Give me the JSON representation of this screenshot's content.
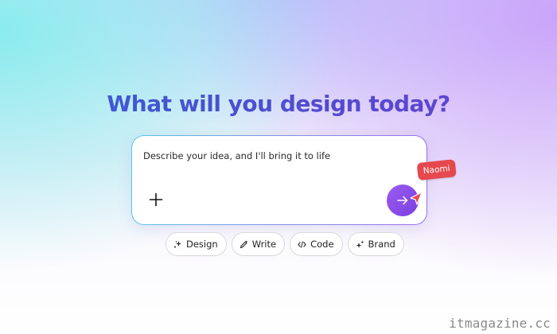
{
  "headline": "What will you design today?",
  "prompt": {
    "placeholder": "Describe your idea, and I'll bring it to life",
    "add_icon": "plus-icon",
    "send_icon": "arrow-right-icon"
  },
  "collaborator": {
    "name": "Naomi",
    "color": "#e5484d",
    "cursor_icon": "pointer-cursor-icon"
  },
  "chips": [
    {
      "label": "Design",
      "icon": "sparkle-icon"
    },
    {
      "label": "Write",
      "icon": "pen-sparkle-icon"
    },
    {
      "label": "Code",
      "icon": "code-icon"
    },
    {
      "label": "Brand",
      "icon": "sparkles-icon"
    }
  ],
  "colors": {
    "accent": "#8b4ee8",
    "headline_start": "#3a5fd6",
    "headline_end": "#6b3fcf"
  },
  "watermark": "itmagazine.cc"
}
